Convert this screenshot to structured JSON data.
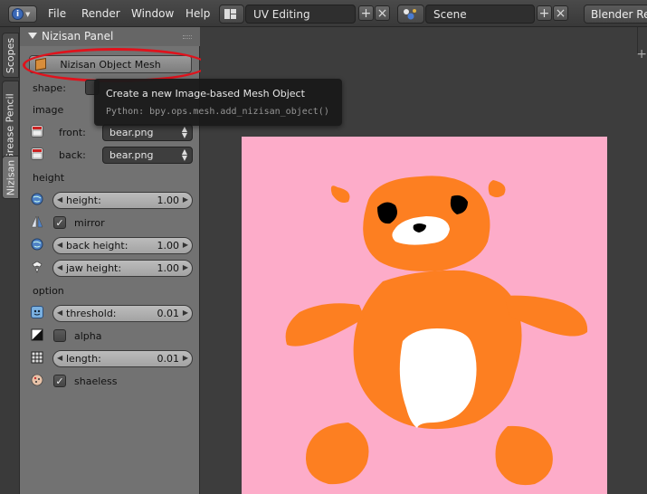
{
  "header": {
    "menus": [
      "File",
      "Render",
      "Window",
      "Help"
    ],
    "screen_layout": "UV Editing",
    "scene": "Scene",
    "render_engine": "Blender Render"
  },
  "tabs": [
    "Scopes",
    "Grease Pencil",
    "Nizisan"
  ],
  "panel": {
    "title": "Nizisan Panel",
    "add_button": "Nizisan Object Mesh",
    "shape_label": "shape:",
    "image_section": "image",
    "front_label": "front:",
    "front_value": "bear.png",
    "back_label": "back:",
    "back_value": "bear.png",
    "height_section": "height",
    "height_label": "height:",
    "height_value": "1.00",
    "mirror_label": "mirror",
    "back_height_label": "back height:",
    "back_height_value": "1.00",
    "jaw_height_label": "jaw height:",
    "jaw_height_value": "1.00",
    "option_section": "option",
    "threshold_label": "threshold:",
    "threshold_value": "0.01",
    "alpha_label": "alpha",
    "length_label": "length:",
    "length_value": "0.01",
    "shaeless_label": "shaeless"
  },
  "tooltip": {
    "title": "Create a new Image-based Mesh Object",
    "python": "Python: bpy.ops.mesh.add_nizisan_object()"
  },
  "colors": {
    "highlight_ring": "#e0121c",
    "image_background": "#fdacc9",
    "bear_orange": "#fd7f21"
  }
}
